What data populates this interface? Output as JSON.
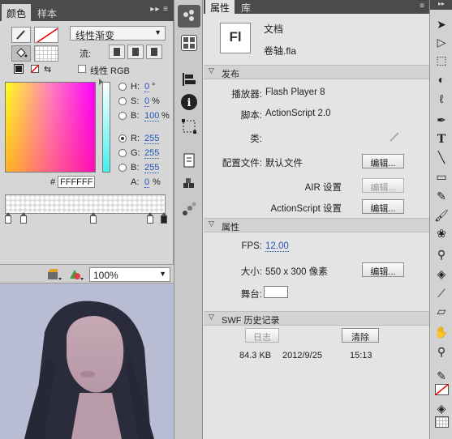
{
  "color_panel": {
    "tabs": [
      "颜色",
      "样本"
    ],
    "fill_type": "线性渐变",
    "flow_label": "流:",
    "linear_rgb_label": "线性 RGB",
    "hsb": [
      {
        "label": "H:",
        "value": "0",
        "unit": "°"
      },
      {
        "label": "S:",
        "value": "0",
        "unit": "%"
      },
      {
        "label": "B:",
        "value": "100",
        "unit": "%"
      }
    ],
    "rgb": [
      {
        "label": "R:",
        "value": "255"
      },
      {
        "label": "G:",
        "value": "255"
      },
      {
        "label": "B:",
        "value": "255"
      }
    ],
    "alpha": {
      "label": "A:",
      "value": "0",
      "unit": "%"
    },
    "hex_label": "#",
    "hex_value": "FFFFFF"
  },
  "stage_toolbar": {
    "zoom": "100%"
  },
  "properties": {
    "tabs": [
      "属性",
      "库"
    ],
    "doc_icon_text": "Fl",
    "doc_type": "文档",
    "doc_name": "卷轴.fla",
    "publish_section": "发布",
    "player_label": "播放器:",
    "player_value": "Flash Player 8",
    "script_label": "脚本:",
    "script_value": "ActionScript 2.0",
    "class_label": "类:",
    "profile_label": "配置文件:",
    "profile_value": "默认文件",
    "air_label": "AIR 设置",
    "as_label": "ActionScript 设置",
    "edit_label": "编辑...",
    "props_section": "属性",
    "fps_label": "FPS:",
    "fps_value": "12.00",
    "size_label": "大小:",
    "size_value": "550 x 300 像素",
    "stage_label": "舞台:",
    "stage_color": "#ffffff",
    "swf_section": "SWF 历史记录",
    "log_label": "日志",
    "clear_label": "清除",
    "swf_size": "84.3 KB",
    "swf_date": "2012/9/25",
    "swf_time": "15:13"
  }
}
